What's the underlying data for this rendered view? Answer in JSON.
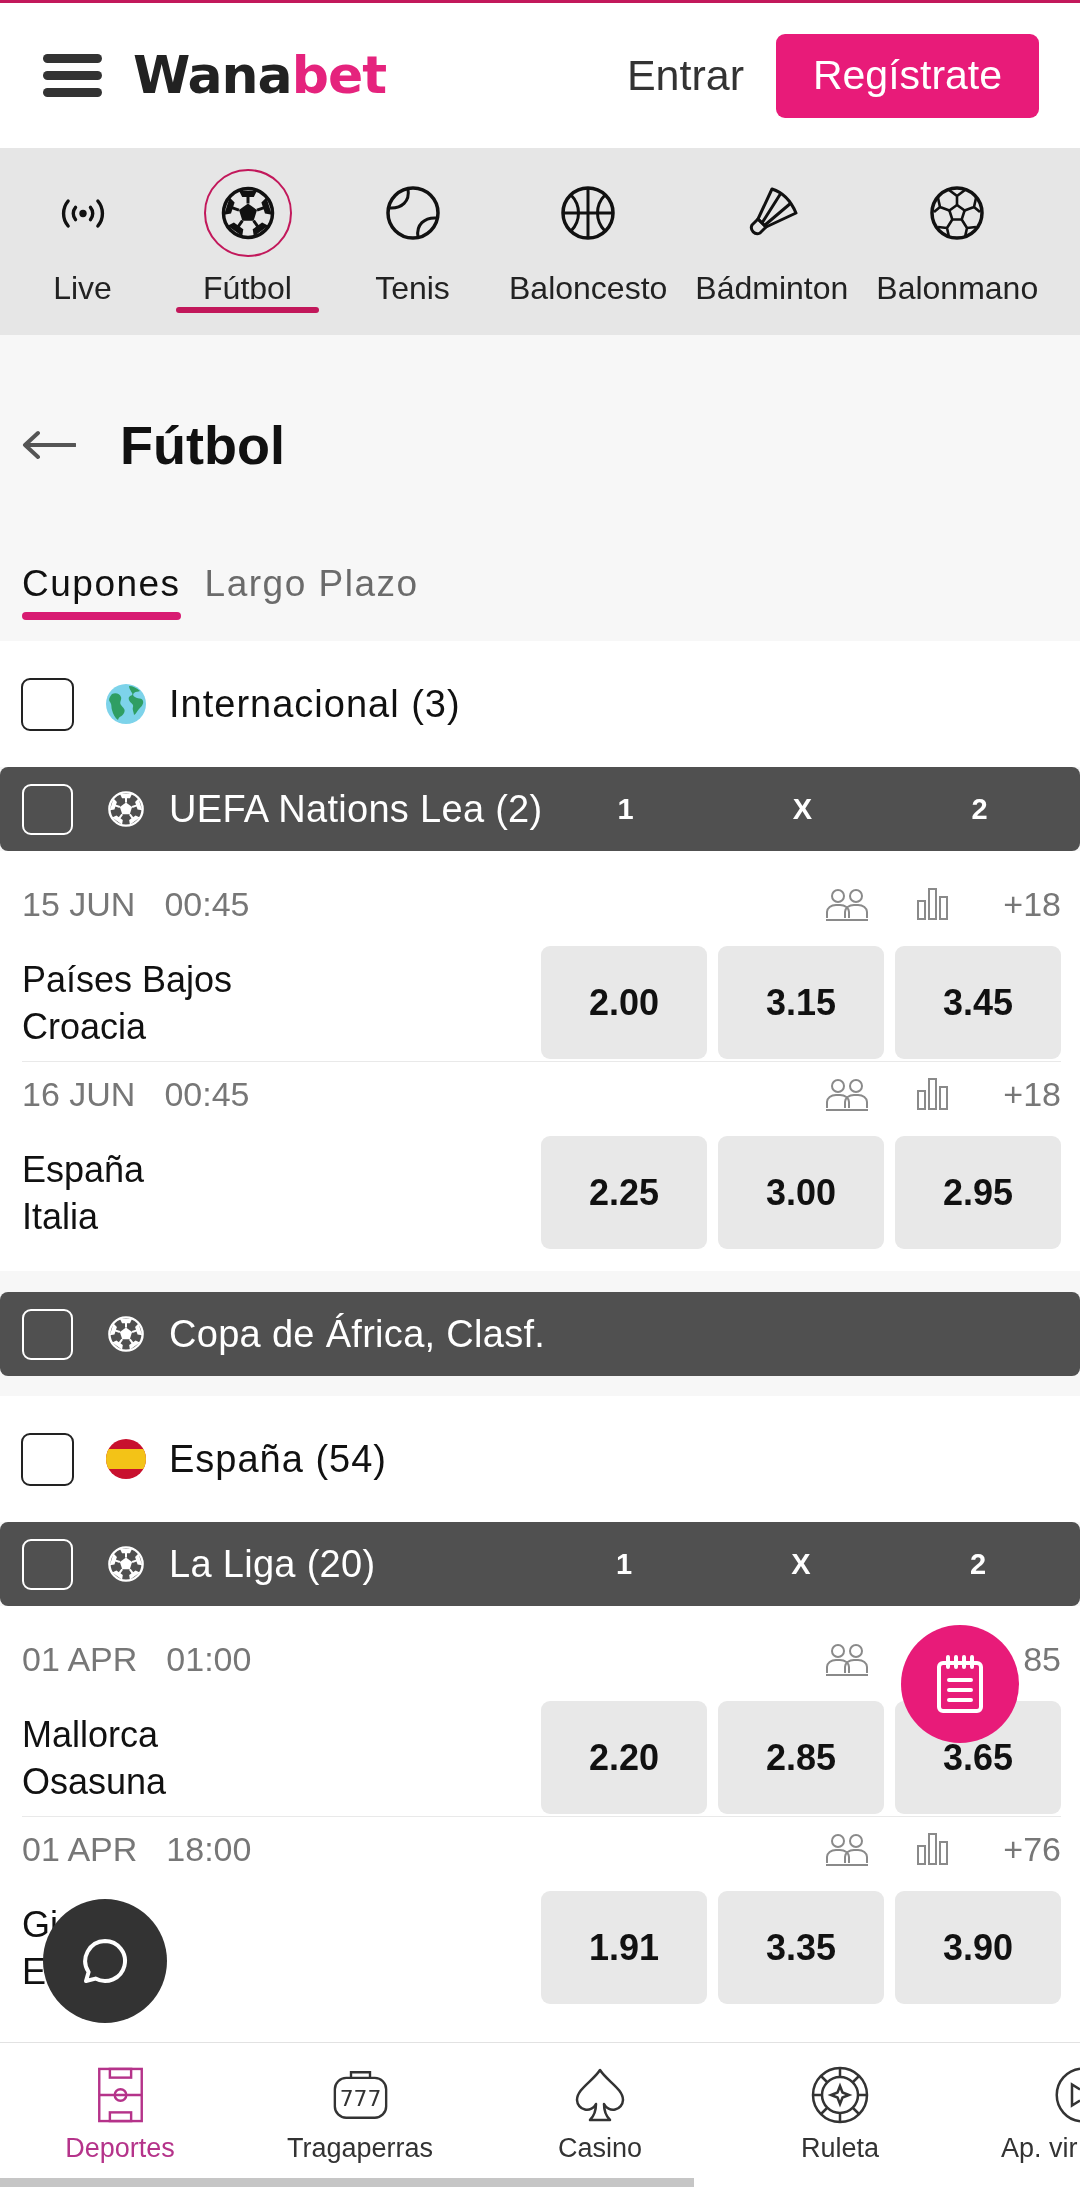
{
  "header": {
    "logo": [
      "Wana",
      "bet"
    ],
    "login": "Entrar",
    "register": "Regístrate"
  },
  "sports": [
    {
      "label": "Live",
      "selected": false
    },
    {
      "label": "Fútbol",
      "selected": true
    },
    {
      "label": "Tenis",
      "selected": false
    },
    {
      "label": "Baloncesto",
      "selected": false
    },
    {
      "label": "Bádminton",
      "selected": false
    },
    {
      "label": "Balonmano",
      "selected": false
    }
  ],
  "page": {
    "title": "Fútbol"
  },
  "tabs": [
    {
      "label": "Cupones",
      "selected": true
    },
    {
      "label": "Largo Plazo",
      "selected": false
    }
  ],
  "regions": [
    {
      "label": "Internacional (3)",
      "checked": false,
      "leagues": [
        {
          "label": "UEFA Nations Lea (2)",
          "checked": false,
          "columns": [
            "1",
            "X",
            "2"
          ],
          "matches": [
            {
              "date": "15 JUN",
              "time": "00:45",
              "stats": true,
              "markets": "+18",
              "home": "Países Bajos",
              "away": "Croacia",
              "odds": [
                "2.00",
                "3.15",
                "3.45"
              ]
            },
            {
              "date": "16 JUN",
              "time": "00:45",
              "stats": true,
              "markets": "+18",
              "home": "España",
              "away": "Italia",
              "odds": [
                "2.25",
                "3.00",
                "2.95"
              ]
            }
          ]
        },
        {
          "label": "Copa de África, Clasf.",
          "checked": false
        }
      ]
    },
    {
      "label": "España (54)",
      "checked": false,
      "leagues": [
        {
          "label": "La Liga (20)",
          "checked": false,
          "columns": [
            "1",
            "X",
            "2"
          ],
          "matches": [
            {
              "date": "01 APR",
              "time": "01:00",
              "stats": false,
              "markets": "85",
              "home": "Mallorca",
              "away": "Osasuna",
              "odds": [
                "2.20",
                "2.85",
                "3.65"
              ]
            },
            {
              "date": "01 APR",
              "time": "18:00",
              "stats": true,
              "markets": "+76",
              "home": "Gi",
              "away": "E",
              "odds": [
                "1.91",
                "3.35",
                "3.90"
              ]
            }
          ]
        }
      ]
    }
  ],
  "bottom_nav": [
    {
      "label": "Deportes",
      "selected": true
    },
    {
      "label": "Tragaperras",
      "icon_text": "777",
      "selected": false
    },
    {
      "label": "Casino",
      "selected": false
    },
    {
      "label": "Ruleta",
      "selected": false
    },
    {
      "label": "Ap. vir",
      "selected": false
    }
  ]
}
